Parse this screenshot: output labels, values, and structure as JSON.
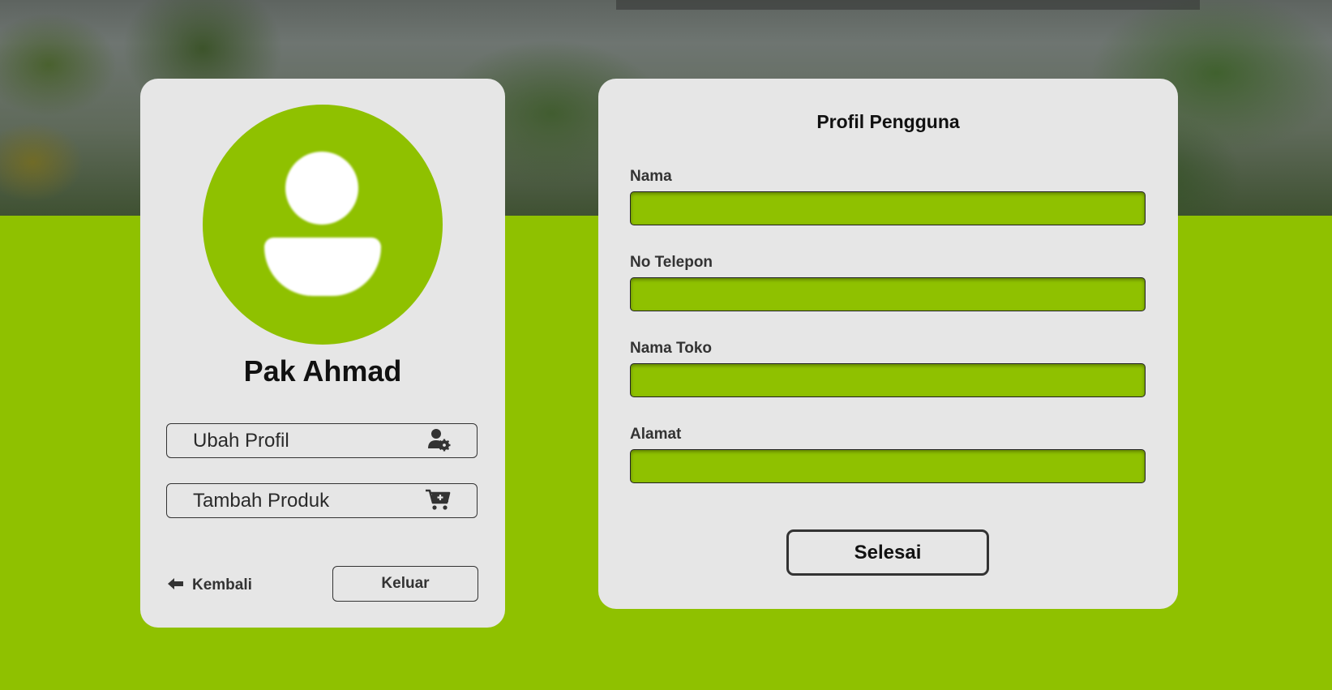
{
  "user": {
    "name": "Pak Ahmad",
    "avatar_icon": "user-avatar-icon"
  },
  "menu": {
    "edit_profile": {
      "label": "Ubah Profil",
      "icon": "user-gear-icon"
    },
    "add_product": {
      "label": "Tambah Produk",
      "icon": "cart-plus-icon"
    },
    "back": {
      "label": "Kembali",
      "icon": "arrow-left-icon"
    },
    "logout": {
      "label": "Keluar"
    }
  },
  "form": {
    "title": "Profil Pengguna",
    "fields": [
      {
        "label": "Nama",
        "value": ""
      },
      {
        "label": "No Telepon",
        "value": ""
      },
      {
        "label": "Nama Toko",
        "value": ""
      },
      {
        "label": "Alamat",
        "value": ""
      }
    ],
    "submit_label": "Selesai"
  },
  "colors": {
    "accent": "#8fc100",
    "card": "#e6e6e6",
    "text": "#111111"
  }
}
